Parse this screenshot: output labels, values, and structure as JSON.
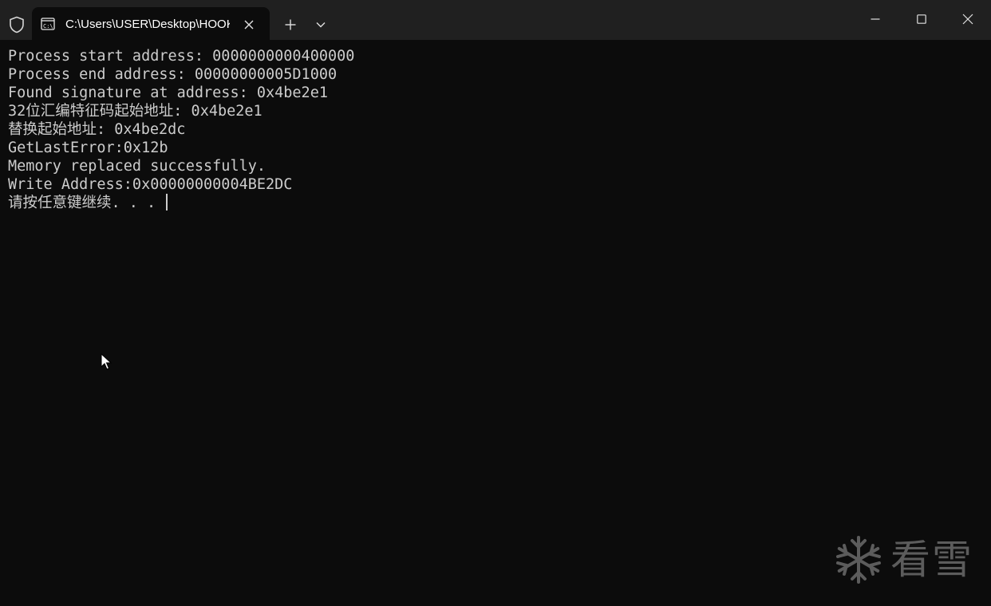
{
  "titlebar": {
    "tab_icon": "console-icon",
    "tab_title": "C:\\Users\\USER\\Desktop\\HOOK",
    "close_tab_icon": "close-icon",
    "new_tab_icon": "plus-icon",
    "dropdown_icon": "chevron-down-icon",
    "shield_icon": "shield-icon",
    "window_controls": [
      "minimize-icon",
      "maximize-icon",
      "close-icon"
    ]
  },
  "console": {
    "lines": [
      "Process start address: 0000000000400000",
      "Process end address: 00000000005D1000",
      "Found signature at address: 0x4be2e1",
      "32位汇编特征码起始地址: 0x4be2e1",
      "替换起始地址: 0x4be2dc",
      "GetLastError:0x12b",
      "Memory replaced successfully.",
      "Write Address:0x00000000004BE2DC",
      "请按任意键继续. . . "
    ]
  },
  "watermark": {
    "text": "看雪",
    "icon": "snowflake-icon"
  },
  "colors": {
    "background": "#0c0c0c",
    "titlebar": "#202020",
    "text": "#cccccc"
  }
}
